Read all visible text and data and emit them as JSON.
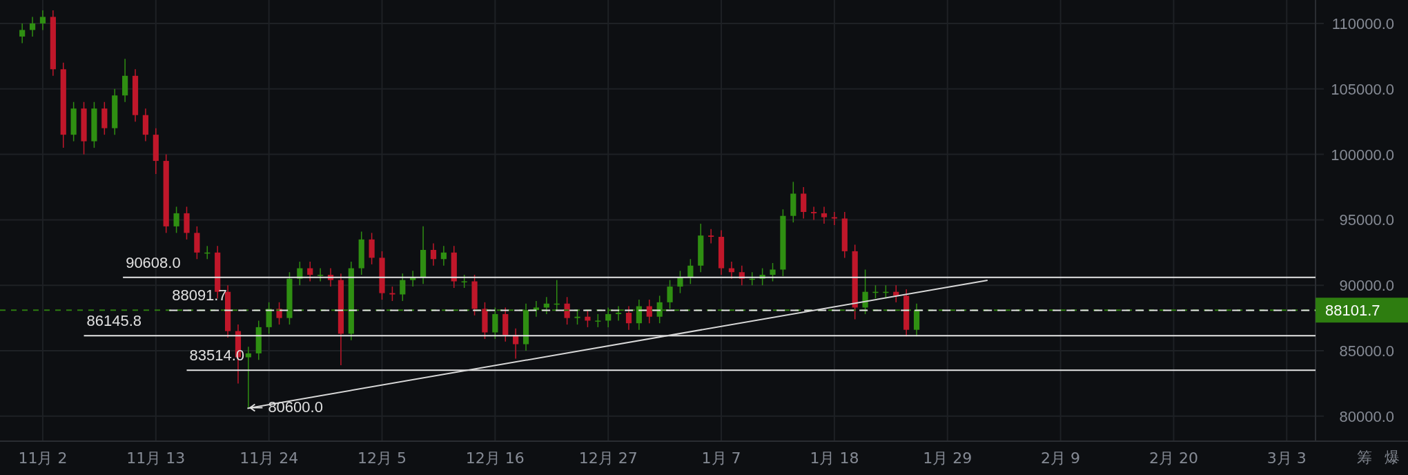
{
  "chart": {
    "chart_data": {
      "type": "candlestick",
      "categories": [
        null,
        null,
        "11月 2",
        null,
        null,
        null,
        null,
        null,
        null,
        null,
        null,
        null,
        null,
        "11月 13",
        null,
        null,
        null,
        null,
        null,
        null,
        null,
        null,
        null,
        null,
        "11月 24",
        null,
        null,
        null,
        null,
        null,
        null,
        null,
        null,
        null,
        null,
        "12月 5",
        null,
        null,
        null,
        null,
        null,
        null,
        null,
        null,
        null,
        null,
        "12月 16",
        null,
        null,
        null,
        null,
        null,
        null,
        null,
        null,
        null,
        null,
        "12月 27",
        null,
        null,
        null,
        null,
        null,
        null,
        null,
        null,
        null,
        null,
        "1月 7",
        null,
        null,
        null,
        null,
        null,
        null,
        null,
        null,
        null,
        null,
        "1月 18",
        null,
        null,
        null,
        null,
        null,
        null,
        null,
        null,
        null,
        null,
        "1月 29",
        null,
        null,
        null,
        null,
        null,
        null,
        null,
        null,
        null,
        null,
        "2月 9",
        null,
        null,
        null,
        null,
        null,
        null,
        null,
        null,
        null,
        null,
        "2月 20",
        null,
        null,
        null,
        null,
        null,
        null,
        null,
        null,
        null,
        null,
        "3月 3"
      ],
      "ohlc": [
        [
          109000,
          110000,
          108500,
          109500
        ],
        [
          109500,
          110500,
          109000,
          110000
        ],
        [
          110000,
          111000,
          109500,
          110500
        ],
        [
          110500,
          111000,
          106000,
          106500
        ],
        [
          106500,
          107000,
          100500,
          101500
        ],
        [
          101500,
          104000,
          101000,
          103500
        ],
        [
          103500,
          104000,
          100000,
          101000
        ],
        [
          101000,
          104000,
          100500,
          103500
        ],
        [
          103500,
          104000,
          101500,
          102000
        ],
        [
          102000,
          105000,
          101500,
          104500
        ],
        [
          104500,
          107300,
          104000,
          106000
        ],
        [
          106000,
          106500,
          102500,
          103000
        ],
        [
          103000,
          103500,
          101000,
          101500
        ],
        [
          101500,
          102000,
          98500,
          99500
        ],
        [
          99500,
          100000,
          94000,
          94500
        ],
        [
          94500,
          96000,
          94000,
          95500
        ],
        [
          95500,
          96000,
          93500,
          94000
        ],
        [
          94000,
          94500,
          92000,
          92500
        ],
        [
          92500,
          93000,
          92000,
          92500
        ],
        [
          92500,
          93000,
          89000,
          89500
        ],
        [
          89500,
          90000,
          86000,
          86500
        ],
        [
          86500,
          87000,
          82500,
          84500
        ],
        [
          84500,
          85300,
          80600,
          84800
        ],
        [
          84800,
          87300,
          84300,
          86800
        ],
        [
          86800,
          88700,
          86300,
          88200
        ],
        [
          88200,
          88700,
          87000,
          87500
        ],
        [
          87500,
          91000,
          87000,
          90500
        ],
        [
          90500,
          91800,
          90000,
          91300
        ],
        [
          91300,
          91800,
          90300,
          90800
        ],
        [
          90800,
          91300,
          90300,
          90800
        ],
        [
          90800,
          91300,
          89900,
          90400
        ],
        [
          90400,
          90900,
          83900,
          86300
        ],
        [
          86300,
          91800,
          85800,
          91300
        ],
        [
          91300,
          94100,
          90800,
          93500
        ],
        [
          93500,
          94000,
          91600,
          92100
        ],
        [
          92100,
          92600,
          88900,
          89400
        ],
        [
          89400,
          89900,
          88800,
          89300
        ],
        [
          89300,
          90900,
          88800,
          90400
        ],
        [
          90400,
          91100,
          89900,
          90600
        ],
        [
          90600,
          94500,
          90100,
          92700
        ],
        [
          92700,
          93200,
          91500,
          92000
        ],
        [
          92000,
          93000,
          91500,
          92500
        ],
        [
          92500,
          93000,
          89800,
          90300
        ],
        [
          90300,
          90800,
          89800,
          90300
        ],
        [
          90300,
          90800,
          87700,
          88200
        ],
        [
          88200,
          88700,
          85900,
          86400
        ],
        [
          86400,
          88300,
          85900,
          87800
        ],
        [
          87800,
          88300,
          85700,
          86200
        ],
        [
          86200,
          86700,
          84400,
          85500
        ],
        [
          85500,
          88600,
          85000,
          88100
        ],
        [
          88100,
          88800,
          87600,
          88300
        ],
        [
          88300,
          89100,
          87800,
          88600
        ],
        [
          88600,
          90400,
          88100,
          88600
        ],
        [
          88600,
          89100,
          87000,
          87500
        ],
        [
          87500,
          88100,
          87000,
          87600
        ],
        [
          87600,
          88100,
          86800,
          87300
        ],
        [
          87300,
          87800,
          86800,
          87300
        ],
        [
          87300,
          88300,
          86800,
          87800
        ],
        [
          87800,
          88400,
          87300,
          87900
        ],
        [
          87900,
          88400,
          86600,
          87100
        ],
        [
          87100,
          88900,
          86600,
          88400
        ],
        [
          88400,
          88900,
          87100,
          87600
        ],
        [
          87600,
          89200,
          87100,
          88700
        ],
        [
          88700,
          90400,
          88200,
          89900
        ],
        [
          89900,
          91100,
          89400,
          90600
        ],
        [
          90600,
          92000,
          90100,
          91500
        ],
        [
          91500,
          94700,
          91000,
          93800
        ],
        [
          93800,
          94300,
          93200,
          93700
        ],
        [
          93700,
          94200,
          90800,
          91300
        ],
        [
          91300,
          91800,
          90500,
          91000
        ],
        [
          91000,
          91500,
          90000,
          90500
        ],
        [
          90500,
          91000,
          90000,
          90500
        ],
        [
          90500,
          91300,
          90000,
          90800
        ],
        [
          90800,
          91700,
          90300,
          91200
        ],
        [
          91200,
          95800,
          90700,
          95300
        ],
        [
          95300,
          97900,
          94800,
          97000
        ],
        [
          97000,
          97500,
          95100,
          95600
        ],
        [
          95600,
          96000,
          95000,
          95500
        ],
        [
          95500,
          96000,
          94700,
          95200
        ],
        [
          95200,
          95600,
          94600,
          95100
        ],
        [
          95100,
          95600,
          92100,
          92600
        ],
        [
          92600,
          93100,
          87400,
          88300
        ],
        [
          88300,
          91200,
          87800,
          89500
        ],
        [
          89500,
          90000,
          89000,
          89500
        ],
        [
          89500,
          90000,
          89000,
          89500
        ],
        [
          89500,
          90000,
          88700,
          89200
        ],
        [
          89200,
          89700,
          86100,
          86600
        ],
        [
          86600,
          88600,
          86100,
          88100
        ],
        null,
        null,
        null,
        null,
        null,
        null,
        null,
        null,
        null,
        null,
        null,
        null,
        null,
        null,
        null,
        null,
        null,
        null,
        null,
        null,
        null,
        null,
        null,
        null,
        null,
        null,
        null,
        null,
        null,
        null,
        null,
        null,
        null,
        null,
        null,
        null
      ],
      "ylim": [
        78040,
        111790
      ],
      "grid": true,
      "yticks": [
        {
          "value": 80000,
          "label": "80000.0"
        },
        {
          "value": 85000,
          "label": "85000.0"
        },
        {
          "value": 90000,
          "label": "90000.0"
        },
        {
          "value": 95000,
          "label": "95000.0"
        },
        {
          "value": 100000,
          "label": "100000.0"
        },
        {
          "value": 105000,
          "label": "105000.0"
        },
        {
          "value": 110000,
          "label": "110000.0"
        }
      ]
    },
    "current_price": {
      "label": "88101.7"
    },
    "drawings": [
      {
        "kind": "solid",
        "label": "90608.0"
      },
      {
        "kind": "dashed",
        "label": "88091.7"
      },
      {
        "kind": "solid",
        "label": "86145.8"
      },
      {
        "kind": "solid",
        "label": "83514.0"
      },
      {
        "kind": "trend",
        "label": "80600.0"
      }
    ]
  },
  "tools": [
    {
      "label": "筹"
    },
    {
      "label": "爆"
    }
  ]
}
